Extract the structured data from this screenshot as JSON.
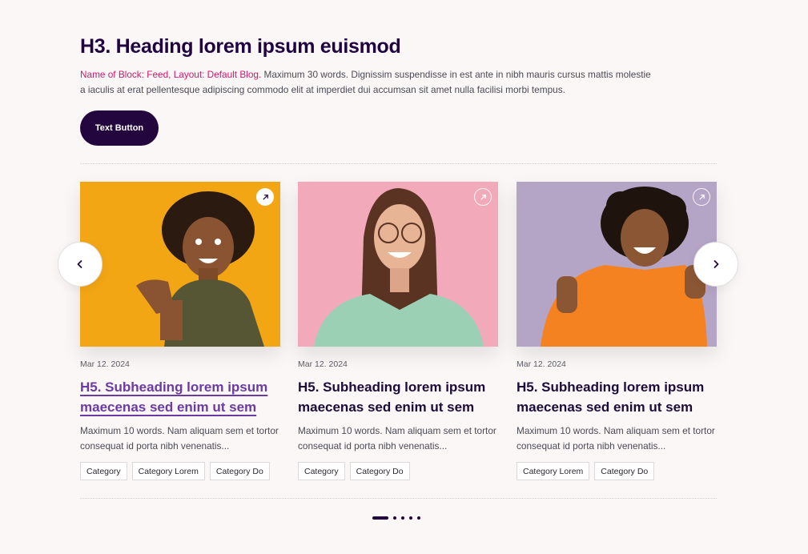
{
  "header": {
    "heading": "H3. Heading lorem ipsum euismod",
    "intro_highlight": "Name of Block: Feed, Layout: Default Blog.",
    "intro_text": " Maximum 30 words. Dignissim suspendisse in est ante in nibh mauris cursus mattis molestie a iaculis at erat pellentesque adipiscing commodo elit at imperdiet dui accumsan sit amet nulla facilisi morbi tempus.",
    "button_label": "Text Button"
  },
  "colors": {
    "accent": "#24063f",
    "highlight": "#d2176b",
    "hover_link": "#6c3aa3"
  },
  "carousel": {
    "prev_icon": "chevron-left-icon",
    "next_icon": "chevron-right-icon",
    "cards": [
      {
        "date": "Mar 12. 2024",
        "title": "H5. Subheading lorem ipsum maecenas sed enim ut sem",
        "excerpt": "Maximum 10 words. Nam aliquam sem et tortor consequat id porta nibh venenatis...",
        "tags": [
          "Category",
          "Category Lorem",
          "Category Do"
        ],
        "image_icon": "arrow-up-right-icon"
      },
      {
        "date": "Mar 12. 2024",
        "title": "H5. Subheading lorem ipsum maecenas sed enim ut sem",
        "excerpt": "Maximum 10 words. Nam aliquam sem et tortor consequat id porta nibh venenatis...",
        "tags": [
          "Category",
          "Category Do"
        ],
        "image_icon": "arrow-up-right-icon"
      },
      {
        "date": "Mar 12. 2024",
        "title": "H5. Subheading lorem ipsum maecenas sed enim ut sem",
        "excerpt": "Maximum 10 words. Nam aliquam sem et tortor consequat id porta nibh venenatis...",
        "tags": [
          "Category Lorem",
          "Category Do"
        ],
        "image_icon": "arrow-up-right-icon"
      }
    ],
    "pager": {
      "total": 5,
      "active": 1
    }
  }
}
